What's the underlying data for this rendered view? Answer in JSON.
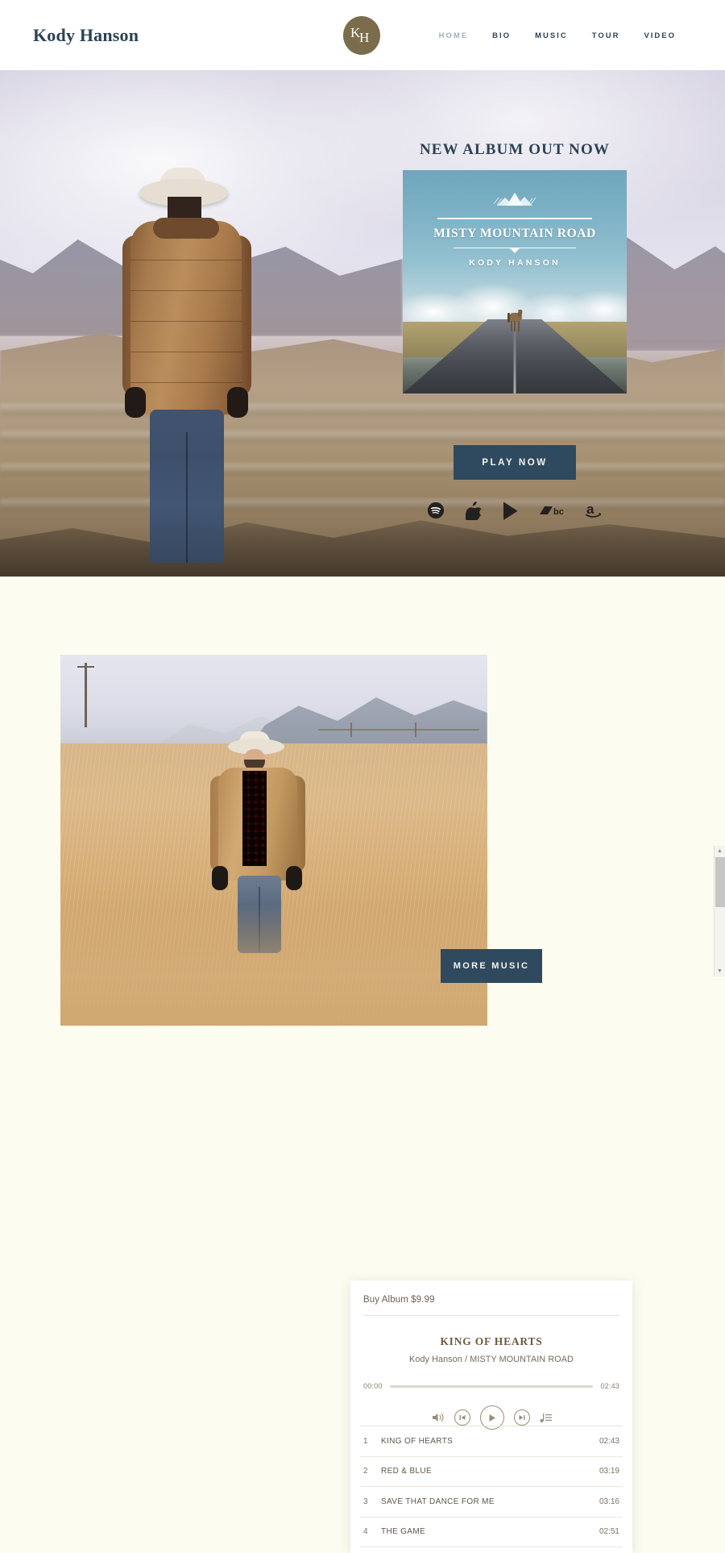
{
  "header": {
    "wordmark": "Kody Hanson",
    "logo": {
      "letter1": "K",
      "letter2": "H",
      "bg_color": "#7b6c4c"
    },
    "nav": [
      {
        "label": "HOME",
        "active": true
      },
      {
        "label": "BIO",
        "active": false
      },
      {
        "label": "MUSIC",
        "active": false
      },
      {
        "label": "TOUR",
        "active": false
      },
      {
        "label": "VIDEO",
        "active": false
      }
    ]
  },
  "hero": {
    "promo_title": "NEW ALBUM OUT NOW",
    "album": {
      "title": "MISTY MOUNTAIN ROAD",
      "artist": "KODY HANSON"
    },
    "play_button": "PLAY NOW",
    "stores": [
      {
        "name": "spotify-icon",
        "label": "Spotify"
      },
      {
        "name": "apple-music-icon",
        "label": "Apple Music"
      },
      {
        "name": "google-play-icon",
        "label": "Google Play"
      },
      {
        "name": "bandcamp-icon",
        "label": "bc"
      },
      {
        "name": "amazon-icon",
        "label": "Amazon"
      }
    ]
  },
  "player": {
    "buy_label": "Buy Album $9.99",
    "now_playing_title": "KING OF HEARTS",
    "now_playing_subtitle": "Kody Hanson / MISTY MOUNTAIN ROAD",
    "time_current": "00:00",
    "time_total": "02:43",
    "progress_percent": 0,
    "controls": [
      {
        "name": "volume-icon",
        "label": "Volume"
      },
      {
        "name": "previous-track-icon",
        "label": "Previous"
      },
      {
        "name": "play-icon",
        "label": "Play"
      },
      {
        "name": "next-track-icon",
        "label": "Next"
      },
      {
        "name": "playlist-icon",
        "label": "Playlist"
      }
    ],
    "tracks": [
      {
        "num": "1",
        "name": "KING OF HEARTS",
        "duration": "02:43"
      },
      {
        "num": "2",
        "name": "RED & BLUE",
        "duration": "03:19"
      },
      {
        "num": "3",
        "name": "SAVE THAT DANCE FOR ME",
        "duration": "03:16"
      },
      {
        "num": "4",
        "name": "THE GAME",
        "duration": "02:51"
      }
    ]
  },
  "section2": {
    "more_music_button": "MORE MUSIC"
  },
  "colors": {
    "navy": "#2c4254",
    "button_navy": "#2f4a5e",
    "cream": "#fdfcf0",
    "olive": "#7b6c4c",
    "nav_active": "#9fb0bd"
  }
}
